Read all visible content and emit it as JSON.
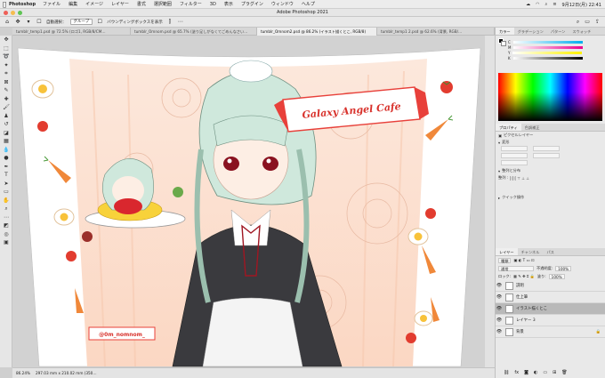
{
  "menubar": {
    "apple": "",
    "app": "Photoshop",
    "items": [
      "ファイル",
      "編集",
      "イメージ",
      "レイヤー",
      "書式",
      "選択範囲",
      "フィルター",
      "3D",
      "表示",
      "プラグイン",
      "ウィンドウ",
      "ヘルプ"
    ],
    "clock": "9月12日(月)  22:41"
  },
  "window": {
    "title": "Adobe Photoshop 2021"
  },
  "options": {
    "auto_select": "自動選択：",
    "group": "グループ",
    "bounding_box": "バウンディングボックスを表示"
  },
  "tabs": [
    "tumblr_temp1.psd @ 72.5% (ロゴ1, RGB/8/CM…",
    "tumblr_Omnom.psd @ 65.7% (塗り足しがなくてごめんなさい…",
    "tumblr_Omnom2.psd @ 86.2% (イラスト描くとこ, RGB/8)",
    "tumblr_temp1 2.psd @ 62.6% (背景, RGB/…"
  ],
  "artwork": {
    "banner": "Galaxy Angel Cafe",
    "handle": "@0m_nomnom_"
  },
  "status": {
    "zoom": "86.24%",
    "doc": "297.03 mm x 210.02 mm (350…"
  },
  "color_panel": {
    "tabs": [
      "カラー",
      "グラデーション",
      "パターン",
      "スウォッチ"
    ],
    "channels": [
      "C",
      "M",
      "Y",
      "K"
    ]
  },
  "properties": {
    "tabs": [
      "プロパティ",
      "色調補正"
    ],
    "kind": "ピクセルレイヤー",
    "transform": "変形",
    "align": "整列と分布",
    "align_label": "整列 :",
    "quick": "クイック操作"
  },
  "layers_panel": {
    "tabs": [
      "レイヤー",
      "チャンネル",
      "パス"
    ],
    "kind": "種類",
    "blend": "通常",
    "opacity_label": "不透明度:",
    "opacity": "100%",
    "lock_label": "ロック:",
    "fill_label": "塗り:",
    "fill": "100%",
    "layers": [
      "説明",
      "仕上筆",
      "イラスト描くとこ",
      "レイヤー 3",
      "背景"
    ]
  },
  "colors": {
    "accent": "#e8403a",
    "panel": "#e9e9e9",
    "canvas_bg": "#d2d2d2"
  }
}
